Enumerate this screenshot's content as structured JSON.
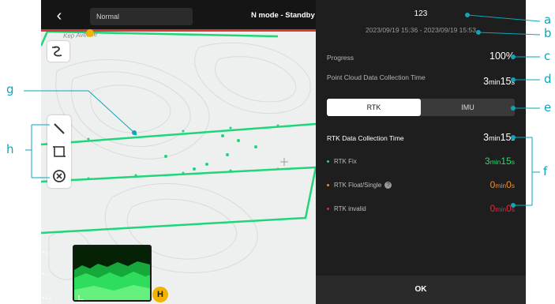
{
  "map": {
    "mode_label": "Normal",
    "status": "N mode - Standby",
    "street": "Kep Avenue",
    "home_marker": "H",
    "legend": [
      "• ◇ .",
      "• - -",
      "• L2"
    ]
  },
  "panel": {
    "title": "123",
    "time_range": "2023/09/19 15:36 - 2023/09/19 15:53",
    "progress_label": "Progress",
    "progress_value": "100%",
    "pc_label": "Point Cloud Data Collection Time",
    "pc_value_num1": "3",
    "pc_value_unit1": "min",
    "pc_value_num2": "15",
    "pc_value_unit2": "s",
    "tabs": [
      "RTK",
      "IMU"
    ],
    "rtk_time_label": "RTK Data Collection Time",
    "rtk_time": {
      "n1": "3",
      "u1": "min",
      "n2": "15",
      "u2": "s"
    },
    "rtk_fix": {
      "label": "RTK Fix",
      "n1": "3",
      "u1": "min",
      "n2": "15",
      "u2": "s"
    },
    "rtk_float": {
      "label": "RTK Float/Single",
      "n1": "0",
      "u1": "min",
      "n2": "0",
      "u2": "s"
    },
    "rtk_invalid": {
      "label": "RTK invalid",
      "n1": "0",
      "u1": "min",
      "n2": "0",
      "u2": "s"
    },
    "ok_label": "OK"
  },
  "callouts": [
    "a",
    "b",
    "c",
    "d",
    "e",
    "f",
    "g",
    "h"
  ],
  "colors": {
    "flight_line": "#1fd67a",
    "panel_bg": "#1e1e1e",
    "callout": "#0ea5b8",
    "rtk_fix": "#2ed573",
    "rtk_float": "#f08c2a",
    "rtk_invalid": "#e0283a"
  }
}
